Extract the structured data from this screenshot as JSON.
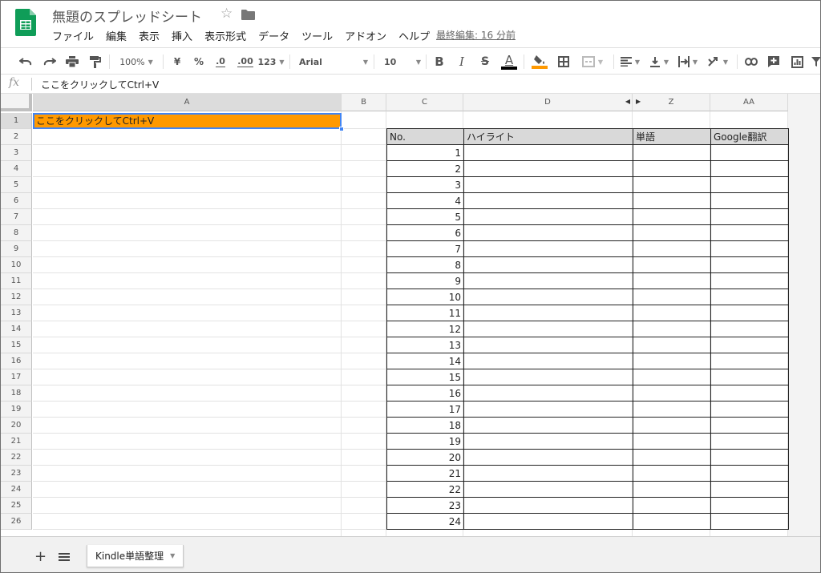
{
  "app": {
    "doc_title": "無題のスプレッドシート",
    "last_edit": "最終編集: 16 分前",
    "menu": [
      "ファイル",
      "編集",
      "表示",
      "挿入",
      "表示形式",
      "データ",
      "ツール",
      "アドオン",
      "ヘルプ"
    ]
  },
  "toolbar": {
    "zoom": "100%",
    "currency": "¥",
    "percent": "%",
    "decimal_decrease": ".0",
    "decimal_increase": ".00",
    "format_more": "123",
    "font": "Arial",
    "font_size": "10",
    "bold": "B",
    "italic": "I",
    "strike": "S",
    "text_color": "A",
    "text_color_value": "#000000",
    "fill_color_value": "#ff9900"
  },
  "formula": {
    "fx": "fx",
    "value": "ここをクリックしてCtrl+V"
  },
  "columns": [
    "A",
    "B",
    "C",
    "D",
    "Z",
    "AA"
  ],
  "rows": [
    "1",
    "2",
    "3",
    "4",
    "5",
    "6",
    "7",
    "8",
    "9",
    "10",
    "11",
    "12",
    "13",
    "14",
    "15",
    "16",
    "17",
    "18",
    "19",
    "20",
    "21",
    "22",
    "23",
    "24",
    "25",
    "26"
  ],
  "cells": {
    "a1": "ここをクリックしてCtrl+V",
    "a1_fill": "#ff9900"
  },
  "table": {
    "headers": [
      "No.",
      "ハイライト",
      "単語",
      "Google翻訳"
    ],
    "numbers": [
      "1",
      "2",
      "3",
      "4",
      "5",
      "6",
      "7",
      "8",
      "9",
      "10",
      "11",
      "12",
      "13",
      "14",
      "15",
      "16",
      "17",
      "18",
      "19",
      "20",
      "21",
      "22",
      "23",
      "24"
    ]
  },
  "sheet": {
    "add_label": "+",
    "tab_name": "Kindle単語整理"
  },
  "colors": {
    "brand": "#0f9d58",
    "selection": "#4285f4",
    "header_fill": "#d9d9d9"
  }
}
